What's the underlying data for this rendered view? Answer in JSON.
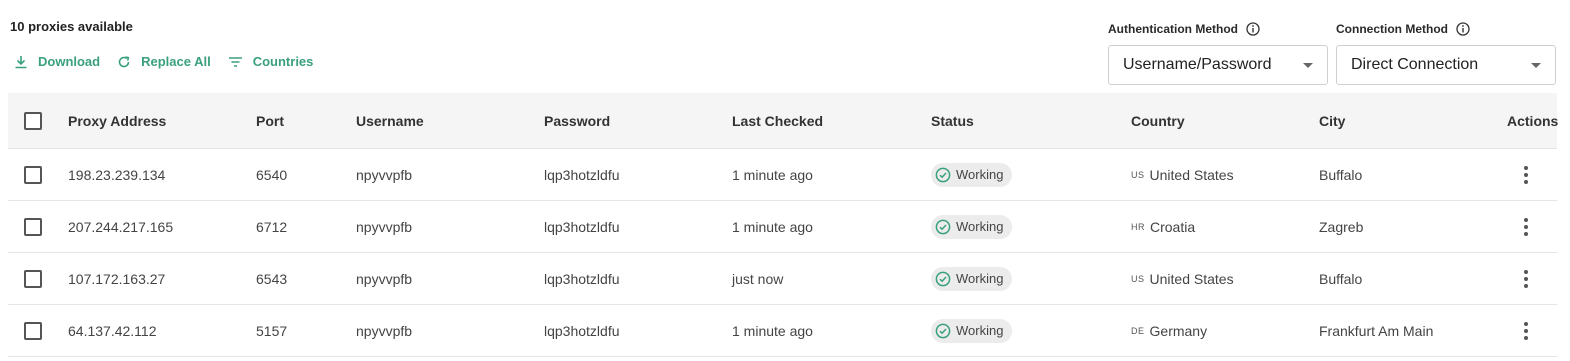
{
  "summary": {
    "count_text": "10 proxies available"
  },
  "toolbar": {
    "download_label": "Download",
    "replace_all_label": "Replace All",
    "countries_label": "Countries"
  },
  "auth": {
    "label": "Authentication Method",
    "value": "Username/Password"
  },
  "connection": {
    "label": "Connection Method",
    "value": "Direct Connection"
  },
  "table": {
    "headers": {
      "proxy_address": "Proxy Address",
      "port": "Port",
      "username": "Username",
      "password": "Password",
      "last_checked": "Last Checked",
      "status": "Status",
      "country": "Country",
      "city": "City",
      "actions": "Actions"
    },
    "rows": [
      {
        "address": "198.23.239.134",
        "port": "6540",
        "username": "npyvvpfb",
        "password": "lqp3hotzldfu",
        "last_checked": "1 minute ago",
        "status": "Working",
        "country_code": "US",
        "country": "United States",
        "city": "Buffalo"
      },
      {
        "address": "207.244.217.165",
        "port": "6712",
        "username": "npyvvpfb",
        "password": "lqp3hotzldfu",
        "last_checked": "1 minute ago",
        "status": "Working",
        "country_code": "HR",
        "country": "Croatia",
        "city": "Zagreb"
      },
      {
        "address": "107.172.163.27",
        "port": "6543",
        "username": "npyvvpfb",
        "password": "lqp3hotzldfu",
        "last_checked": "just now",
        "status": "Working",
        "country_code": "US",
        "country": "United States",
        "city": "Buffalo"
      },
      {
        "address": "64.137.42.112",
        "port": "5157",
        "username": "npyvvpfb",
        "password": "lqp3hotzldfu",
        "last_checked": "1 minute ago",
        "status": "Working",
        "country_code": "DE",
        "country": "Germany",
        "city": "Frankfurt Am Main"
      }
    ]
  },
  "colors": {
    "accent": "#3aa07d",
    "status_ok": "#3aa07d",
    "header_bg": "#f5f5f5"
  }
}
